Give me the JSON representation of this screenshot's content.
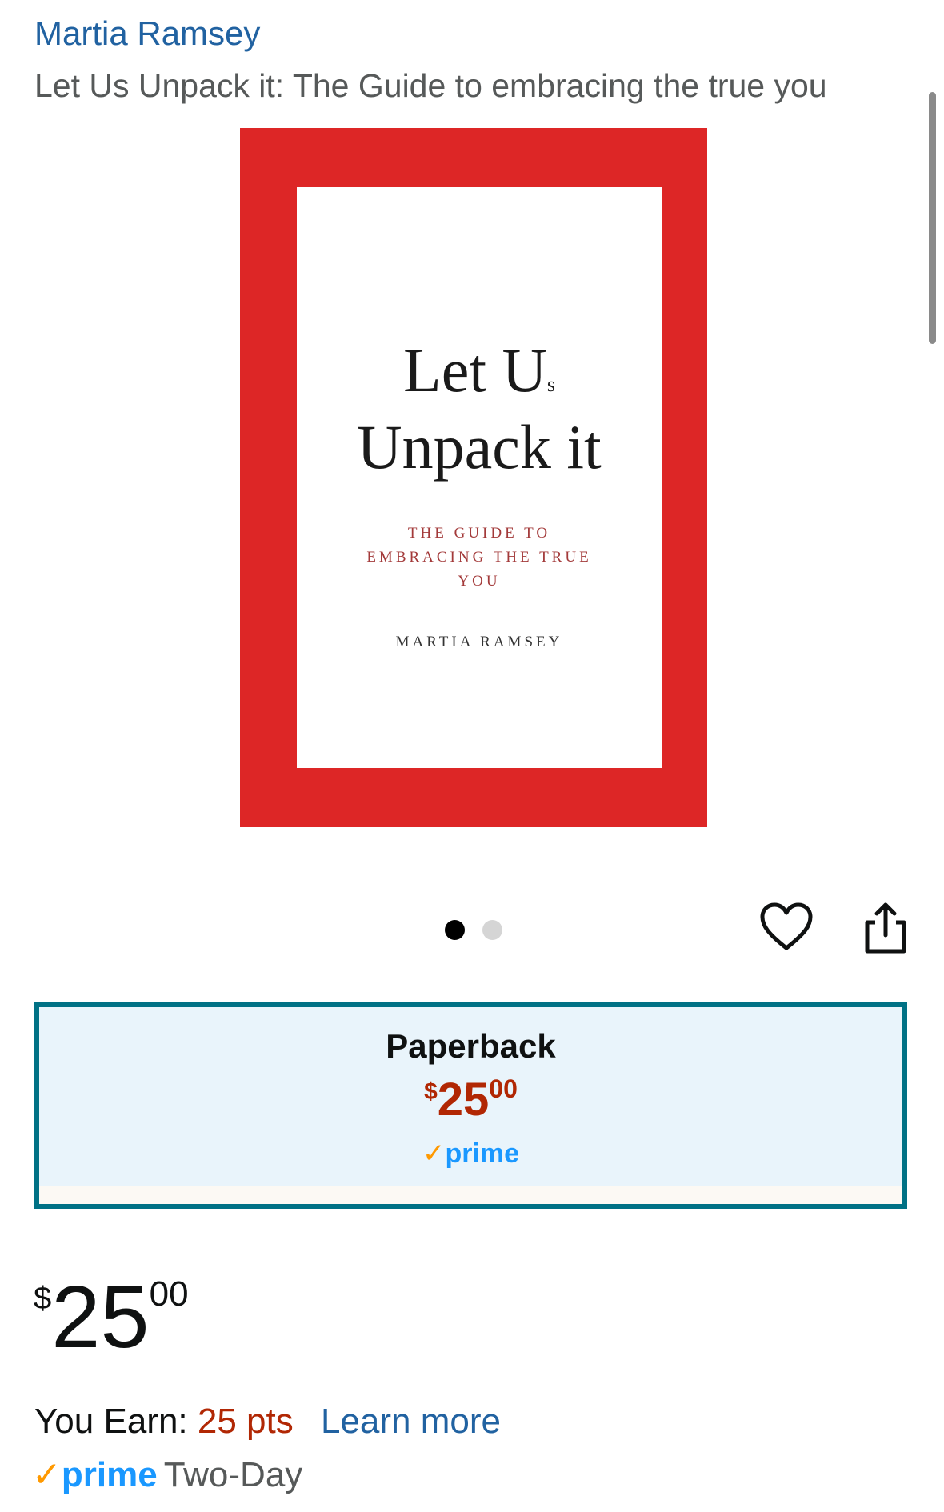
{
  "product": {
    "author": "Martia Ramsey",
    "title": "Let Us Unpack it: The Guide to embracing the true you"
  },
  "cover": {
    "title_line1": "Let U",
    "title_line1_small": "s",
    "title_line2": "Unpack it",
    "subtitle": "THE GUIDE TO EMBRACING THE TRUE YOU",
    "author": "MARTIA RAMSEY",
    "frame_color": "#dd2626"
  },
  "carousel": {
    "total_images": 2,
    "active_index": 0
  },
  "icons": {
    "wishlist": "heart-icon",
    "share": "share-icon"
  },
  "format": {
    "name": "Paperback",
    "price_currency": "$",
    "price_whole": "25",
    "price_fraction": "00",
    "prime_label": "prime",
    "border_color": "#007185"
  },
  "price": {
    "currency": "$",
    "whole": "25",
    "fraction": "00"
  },
  "rewards": {
    "label": "You Earn:",
    "points": "25 pts",
    "learn_more": "Learn more"
  },
  "delivery": {
    "prime_label": "prime",
    "speed": "Two-Day"
  },
  "colors": {
    "link": "#2162a1",
    "price_red": "#b12704",
    "prime_blue": "#1a98ff",
    "check_orange": "#ff9900"
  }
}
